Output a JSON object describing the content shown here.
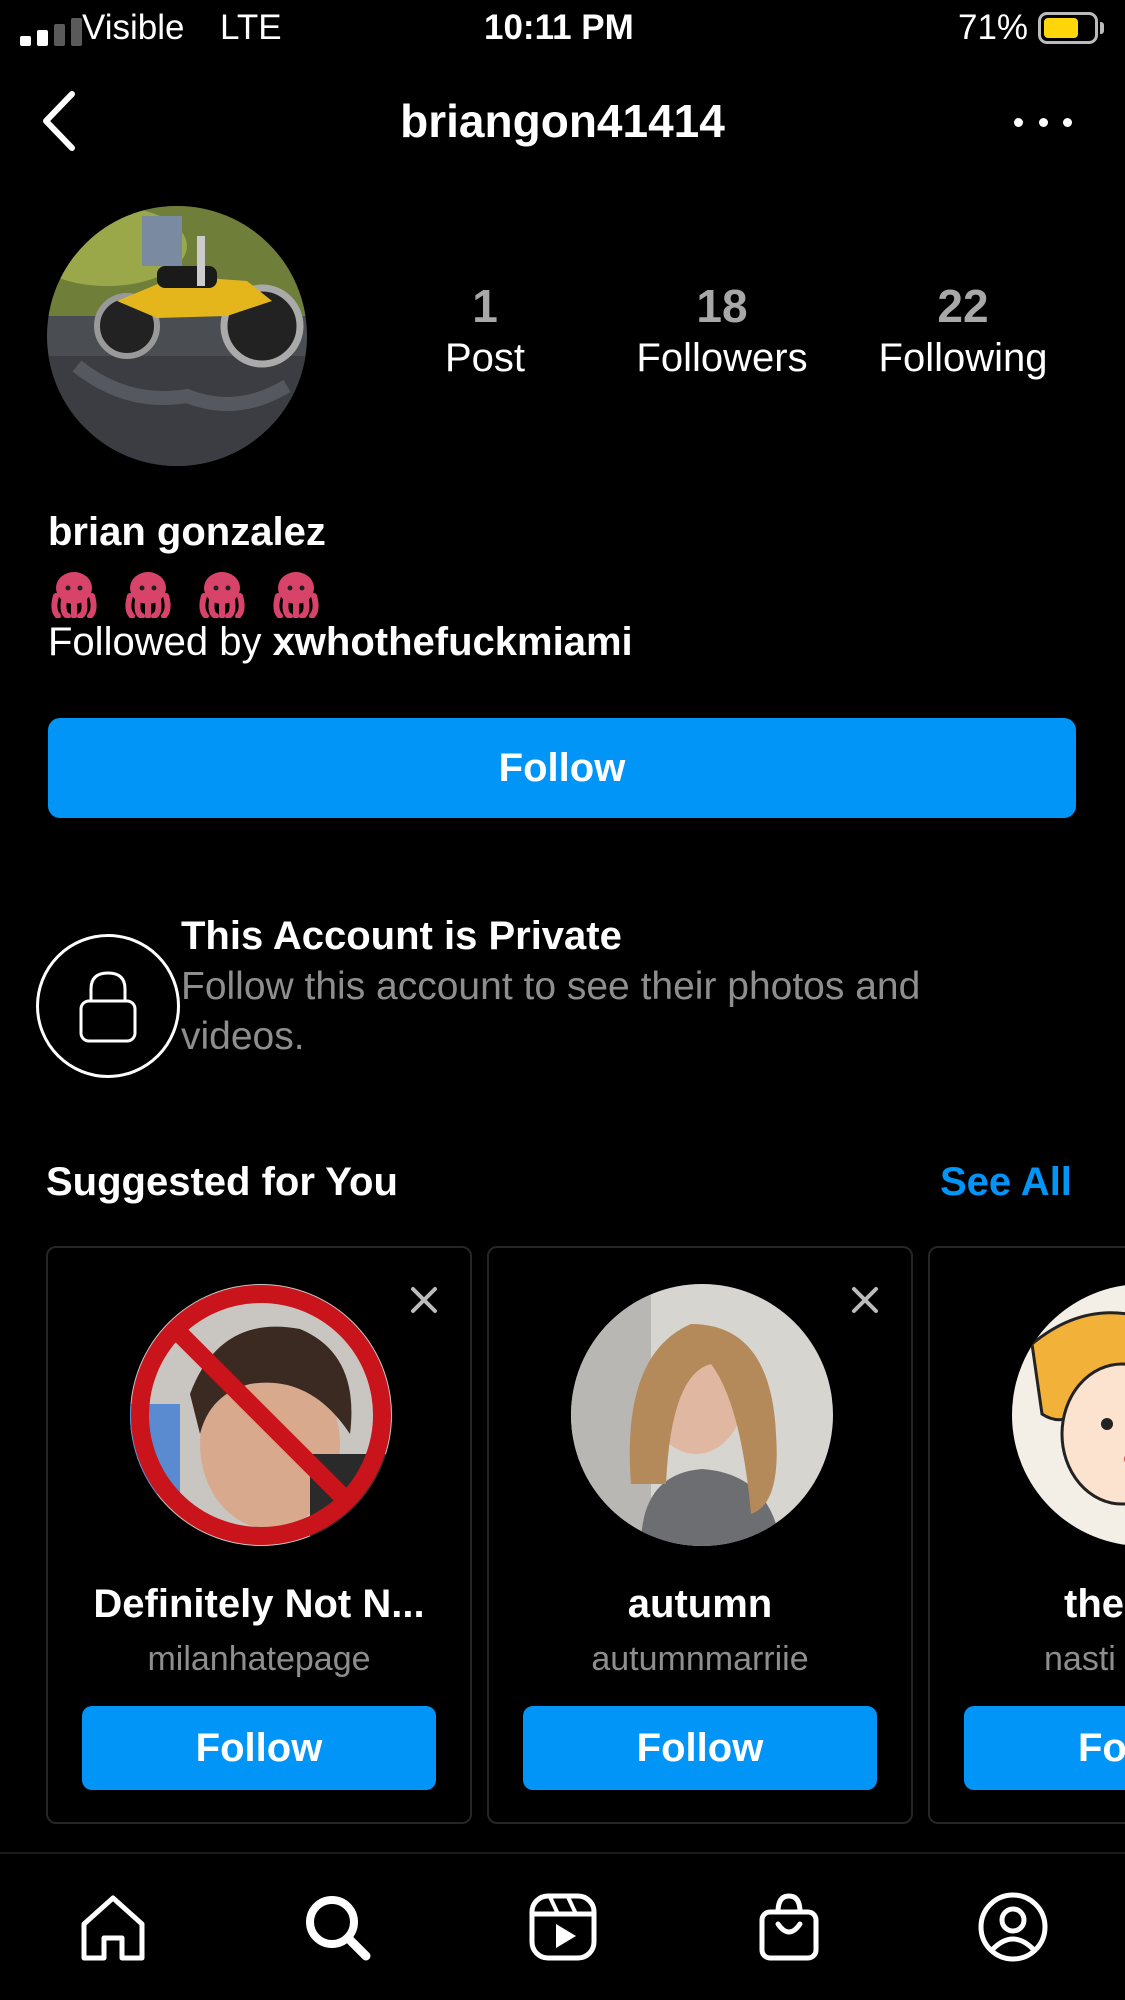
{
  "status_bar": {
    "carrier": "Visible",
    "network": "LTE",
    "time": "10:11 PM",
    "battery_percent": "71%",
    "battery_level": 0.71,
    "battery_color": "#ffd60a"
  },
  "header": {
    "username": "briangon41414"
  },
  "profile": {
    "stats": [
      {
        "value": "1",
        "label": "Post"
      },
      {
        "value": "18",
        "label": "Followers"
      },
      {
        "value": "22",
        "label": "Following"
      }
    ],
    "full_name": "brian gonzalez",
    "bio_emojis": [
      "octopus-emoji",
      "octopus-emoji",
      "octopus-emoji",
      "octopus-emoji"
    ],
    "followed_by_prefix": "Followed by ",
    "followed_by_user": "xwhothefuckmiami",
    "follow_label": "Follow"
  },
  "private_notice": {
    "icon": "lock-icon",
    "title": "This Account is Private",
    "subtitle": "Follow this account to see their photos and videos."
  },
  "suggested": {
    "title": "Suggested for You",
    "see_all": "See All",
    "cards": [
      {
        "name": "Definitely Not N...",
        "username": "milanhatepage",
        "button": "Follow"
      },
      {
        "name": "autumn",
        "username": "autumnmarriie",
        "button": "Follow"
      },
      {
        "name": "the",
        "username": "nasti",
        "button": "Fo"
      }
    ]
  },
  "bottom_nav": {
    "items": [
      "home-icon",
      "search-icon",
      "reels-icon",
      "shop-icon",
      "profile-icon"
    ]
  },
  "colors": {
    "accent": "#0095f6",
    "background": "#000000",
    "secondary_text": "#8e8e8e"
  }
}
